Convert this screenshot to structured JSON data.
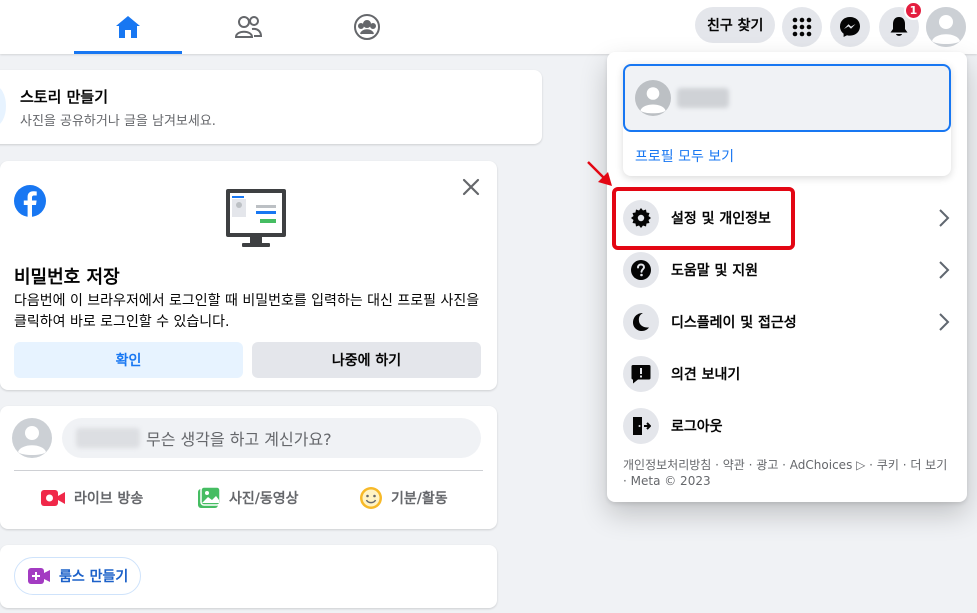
{
  "nav": {
    "find_friends_label": "친구 찾기",
    "notification_count": "1"
  },
  "story": {
    "title": "스토리 만들기",
    "subtitle": "사진을 공유하거나 글을 남겨보세요."
  },
  "password_card": {
    "title": "비밀번호 저장",
    "description": "다음번에 이 브라우저에서 로그인할 때 비밀번호를 입력하는 대신 프로필 사진을 클릭하여 바로 로그인할 수 있습니다.",
    "confirm_label": "확인",
    "later_label": "나중에 하기"
  },
  "composer": {
    "placeholder": "무슨 생각을 하고 계신가요?",
    "actions": [
      {
        "label": "라이브 방송",
        "icon": "live-video-icon",
        "color": "#f02849"
      },
      {
        "label": "사진/동영상",
        "icon": "photo-icon",
        "color": "#45bd62"
      },
      {
        "label": "기분/활동",
        "icon": "feeling-icon",
        "color": "#f7b928"
      }
    ]
  },
  "rooms": {
    "label": "룸스 만들기"
  },
  "menu": {
    "profile_link": "프로필 모두 보기",
    "items": [
      {
        "label": "설정 및 개인정보",
        "icon": "gear-icon"
      },
      {
        "label": "도움말 및 지원",
        "icon": "help-icon"
      },
      {
        "label": "디스플레이 및 접근성",
        "icon": "moon-icon"
      },
      {
        "label": "의견 보내기",
        "icon": "feedback-icon"
      },
      {
        "label": "로그아웃",
        "icon": "logout-icon"
      }
    ],
    "footer": "개인정보처리방침 · 약관 · 광고 · AdChoices ▷ · 쿠키 · 더 보기 · Meta © 2023"
  },
  "colors": {
    "accent": "#1877f2",
    "highlight": "#e30613"
  }
}
